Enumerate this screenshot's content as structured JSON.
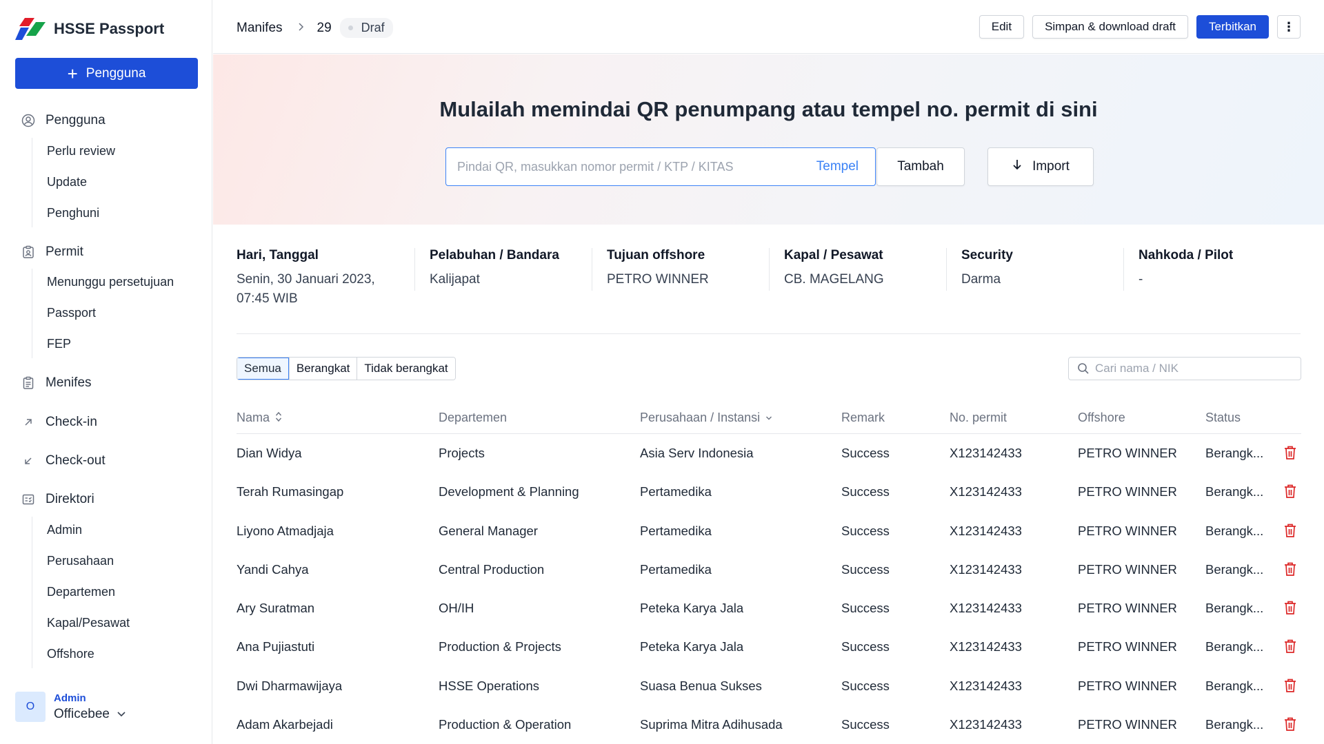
{
  "app": {
    "title": "HSSE Passport"
  },
  "sidebar": {
    "add_button": "Pengguna",
    "groups": [
      {
        "label": "Pengguna",
        "icon": "user-circle-icon",
        "items": [
          "Perlu review",
          "Update",
          "Penghuni"
        ]
      },
      {
        "label": "Permit",
        "icon": "permit-badge-icon",
        "items": [
          "Menunggu persetujuan",
          "Passport",
          "FEP"
        ]
      },
      {
        "label": "Menifes",
        "icon": "clipboard-icon",
        "items": []
      },
      {
        "label": "Check-in",
        "icon": "arrow-up-right-icon",
        "items": []
      },
      {
        "label": "Check-out",
        "icon": "arrow-down-left-icon",
        "items": []
      },
      {
        "label": "Direktori",
        "icon": "directory-icon",
        "items": [
          "Admin",
          "Perusahaan",
          "Departemen",
          "Kapal/Pesawat",
          "Offshore"
        ]
      }
    ],
    "user": {
      "initial": "O",
      "role": "Admin",
      "name": "Officebee"
    }
  },
  "header": {
    "breadcrumb": [
      "Manifes",
      "29"
    ],
    "status": "Draf",
    "actions": {
      "edit": "Edit",
      "save_draft": "Simpan & download draft",
      "publish": "Terbitkan"
    }
  },
  "hero": {
    "title": "Mulailah memindai QR penumpang atau tempel no. permit di sini",
    "input_placeholder": "Pindai QR, masukkan nomor permit / KTP / KITAS",
    "paste": "Tempel",
    "add": "Tambah",
    "import": "Import"
  },
  "info": [
    {
      "label": "Hari, Tanggal",
      "value": "Senin, 30 Januari 2023,",
      "value2": "07:45 WIB"
    },
    {
      "label": "Pelabuhan / Bandara",
      "value": "Kalijapat"
    },
    {
      "label": "Tujuan offshore",
      "value": "PETRO WINNER"
    },
    {
      "label": "Kapal / Pesawat",
      "value": "CB. MAGELANG"
    },
    {
      "label": "Security",
      "value": "Darma"
    },
    {
      "label": "Nahkoda / Pilot",
      "value": "-"
    }
  ],
  "filters": {
    "tabs": [
      "Semua",
      "Berangkat",
      "Tidak berangkat"
    ],
    "active": "Semua",
    "search_placeholder": "Cari nama / NIK"
  },
  "table": {
    "columns": [
      "Nama",
      "Departemen",
      "Perusahaan / Instansi",
      "Remark",
      "No. permit",
      "Offshore",
      "Status"
    ],
    "rows": [
      [
        "Dian Widya",
        "Projects",
        "Asia Serv Indonesia",
        "Success",
        "X123142433",
        "PETRO WINNER",
        "Berangk..."
      ],
      [
        "Terah Rumasingap",
        "Development & Planning",
        "Pertamedika",
        "Success",
        "X123142433",
        "PETRO WINNER",
        "Berangk..."
      ],
      [
        "Liyono Atmadjaja",
        "General Manager",
        "Pertamedika",
        "Success",
        "X123142433",
        "PETRO WINNER",
        "Berangk..."
      ],
      [
        "Yandi Cahya",
        "Central Production",
        "Pertamedika",
        "Success",
        "X123142433",
        "PETRO WINNER",
        "Berangk..."
      ],
      [
        "Ary Suratman",
        "OH/IH",
        "Peteka Karya Jala",
        "Success",
        "X123142433",
        "PETRO WINNER",
        "Berangk..."
      ],
      [
        "Ana Pujiastuti",
        "Production & Projects",
        "Peteka Karya Jala",
        "Success",
        "X123142433",
        "PETRO WINNER",
        "Berangk..."
      ],
      [
        "Dwi Dharmawijaya",
        "HSSE Operations",
        "Suasa Benua Sukses",
        "Success",
        "X123142433",
        "PETRO WINNER",
        "Berangk..."
      ],
      [
        "Adam Akarbejadi",
        "Production & Operation",
        "Suprima Mitra Adihusada",
        "Success",
        "X123142433",
        "PETRO WINNER",
        "Berangk..."
      ]
    ]
  },
  "colors": {
    "primary": "#1d4ed8",
    "accent": "#3b82f6",
    "danger": "#dc2626"
  }
}
